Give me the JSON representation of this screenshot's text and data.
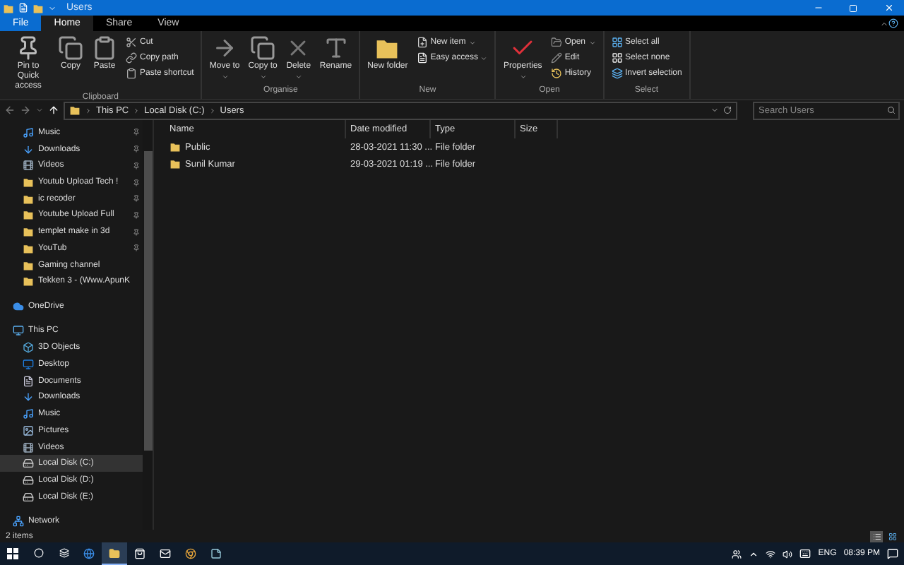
{
  "window": {
    "title": "Users"
  },
  "tabs": [
    {
      "label": "File",
      "kind": "file",
      "selected": false
    },
    {
      "label": "Home",
      "kind": "tab",
      "selected": true
    },
    {
      "label": "Share",
      "kind": "tab",
      "selected": false
    },
    {
      "label": "View",
      "kind": "tab",
      "selected": false
    }
  ],
  "ribbon": [
    {
      "label": "Clipboard",
      "large": [
        {
          "label": "Pin to Quick access",
          "kind": "pin",
          "dropdown": false
        },
        {
          "label": "Copy",
          "kind": "copy",
          "dropdown": false
        },
        {
          "label": "Paste",
          "kind": "paste",
          "dropdown": false
        }
      ],
      "small": [
        {
          "label": "Cut",
          "kind": "cut",
          "dropdown": false
        },
        {
          "label": "Copy path",
          "kind": "path",
          "dropdown": false
        },
        {
          "label": "Paste shortcut",
          "kind": "shortcut",
          "dropdown": false
        }
      ]
    },
    {
      "label": "Organise",
      "large": [
        {
          "label": "Move to",
          "kind": "move",
          "dropdown": true
        },
        {
          "label": "Copy to",
          "kind": "copy",
          "dropdown": true
        },
        {
          "label": "Delete",
          "kind": "delete",
          "dropdown": true
        },
        {
          "label": "Rename",
          "kind": "rename",
          "dropdown": false
        }
      ]
    },
    {
      "label": "New",
      "large": [
        {
          "label": "New folder",
          "kind": "folder",
          "dropdown": false
        }
      ],
      "small": [
        {
          "label": "New item",
          "kind": "newitem",
          "dropdown": true
        },
        {
          "label": "Easy access",
          "kind": "easy",
          "dropdown": true
        }
      ]
    },
    {
      "label": "Open",
      "large": [
        {
          "label": "Properties",
          "kind": "properties",
          "dropdown": true
        }
      ],
      "small": [
        {
          "label": "Open",
          "kind": "open",
          "dropdown": true
        },
        {
          "label": "Edit",
          "kind": "edit",
          "dropdown": false
        },
        {
          "label": "History",
          "kind": "history",
          "dropdown": false
        }
      ]
    },
    {
      "label": "Select",
      "small": [
        {
          "label": "Select all",
          "kind": "selectall",
          "dropdown": false
        },
        {
          "label": "Select none",
          "kind": "selectnone",
          "dropdown": false
        },
        {
          "label": "Invert selection",
          "kind": "invert",
          "dropdown": false
        }
      ]
    }
  ],
  "path": [
    "This PC",
    "Local Disk (C:)",
    "Users"
  ],
  "search": {
    "placeholder": "Search Users"
  },
  "quick_access": [
    {
      "label": "Music",
      "kind": "music",
      "pinned": true
    },
    {
      "label": "Downloads",
      "kind": "download",
      "pinned": true
    },
    {
      "label": "Videos",
      "kind": "video",
      "pinned": true
    },
    {
      "label": "Youtub Upload Tech !",
      "kind": "folder",
      "pinned": true
    },
    {
      "label": "ic recoder",
      "kind": "folder",
      "pinned": true
    },
    {
      "label": "Youtube Upload Full ",
      "kind": "folder",
      "pinned": true
    },
    {
      "label": "templet  make in 3d",
      "kind": "folder",
      "pinned": true
    },
    {
      "label": "YouTub",
      "kind": "folder",
      "pinned": true
    },
    {
      "label": "Gaming channel",
      "kind": "folder",
      "pinned": false
    },
    {
      "label": "Tekken 3 - (Www.ApunK",
      "kind": "folder",
      "pinned": false
    }
  ],
  "sidebar": [
    {
      "label": "OneDrive",
      "kind": "cloud",
      "selected": false
    },
    {
      "label": "This PC",
      "kind": "pc",
      "selected": false,
      "children": [
        {
          "label": "3D Objects",
          "kind": "cube",
          "selected": false
        },
        {
          "label": "Desktop",
          "kind": "desktop",
          "selected": false
        },
        {
          "label": "Documents",
          "kind": "document",
          "selected": false
        },
        {
          "label": "Downloads",
          "kind": "download",
          "selected": false
        },
        {
          "label": "Music",
          "kind": "music",
          "selected": false
        },
        {
          "label": "Pictures",
          "kind": "picture",
          "selected": false
        },
        {
          "label": "Videos",
          "kind": "video",
          "selected": false
        },
        {
          "label": "Local Disk (C:)",
          "kind": "drive",
          "selected": true
        },
        {
          "label": "Local Disk (D:)",
          "kind": "drive",
          "selected": false
        },
        {
          "label": "Local Disk (E:)",
          "kind": "drive",
          "selected": false
        }
      ]
    },
    {
      "label": "Network",
      "kind": "network",
      "selected": false
    }
  ],
  "table": {
    "columns": [
      "Name",
      "Date modified",
      "Type",
      "Size"
    ],
    "rows": [
      {
        "name": "Public",
        "date": "28-03-2021 11:30 ...",
        "type": "File folder"
      },
      {
        "name": "Sunil Kumar",
        "date": "29-03-2021 01:19 ...",
        "type": "File folder"
      }
    ]
  },
  "status_bar": {
    "text": "2 items",
    "views": [
      {
        "kind": "details",
        "selected": true
      },
      {
        "kind": "tiles",
        "selected": false
      }
    ]
  },
  "taskbar": {
    "apps": [
      {
        "kind": "edge",
        "active": false
      },
      {
        "kind": "explorer",
        "active": true
      },
      {
        "kind": "store",
        "active": false
      },
      {
        "kind": "mail",
        "active": false
      },
      {
        "kind": "chrome",
        "active": false
      },
      {
        "kind": "notes",
        "active": false
      }
    ],
    "language": "ENG",
    "time": "08:39 PM"
  }
}
